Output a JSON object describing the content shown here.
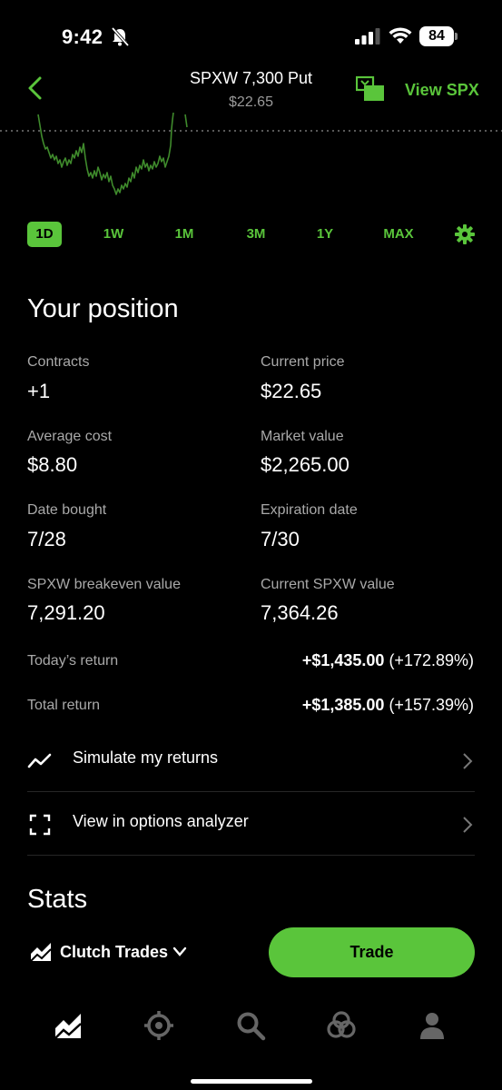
{
  "status": {
    "time": "9:42",
    "battery": "84"
  },
  "header": {
    "title": "SPXW 7,300 Put",
    "subtitle": "$22.65",
    "view_link": "View SPX"
  },
  "colors": {
    "accent": "#5ac53b",
    "background": "#000000",
    "muted_text": "#a9a9a9"
  },
  "range_tabs": [
    {
      "label": "1D",
      "active": true
    },
    {
      "label": "1W",
      "active": false
    },
    {
      "label": "1M",
      "active": false
    },
    {
      "label": "3M",
      "active": false
    },
    {
      "label": "1Y",
      "active": false
    },
    {
      "label": "MAX",
      "active": false
    }
  ],
  "position": {
    "title": "Your position",
    "stats": [
      {
        "label": "Contracts",
        "value": "+1"
      },
      {
        "label": "Current price",
        "value": "$22.65"
      },
      {
        "label": "Average cost",
        "value": "$8.80"
      },
      {
        "label": "Market value",
        "value": "$2,265.00"
      },
      {
        "label": "Date bought",
        "value": "7/28"
      },
      {
        "label": "Expiration date",
        "value": "7/30"
      },
      {
        "label": "SPXW breakeven value",
        "value": "7,291.20"
      },
      {
        "label": "Current SPXW value",
        "value": "7,364.26"
      }
    ],
    "todays_return": {
      "label": "Today’s return",
      "amount": "+$1,435.00",
      "percent": "(+172.89%)"
    },
    "total_return": {
      "label": "Total return",
      "amount": "+$1,385.00",
      "percent": "(+157.39%)"
    }
  },
  "links": {
    "simulate": "Simulate my returns",
    "analyzer": "View in options analyzer"
  },
  "stats_title": "Stats",
  "action_bar": {
    "account": "Clutch Trades",
    "trade": "Trade"
  },
  "tab_bar": {
    "icons": [
      "investing-icon",
      "crypto-icon",
      "search-icon",
      "network-icon",
      "account-icon"
    ]
  }
}
